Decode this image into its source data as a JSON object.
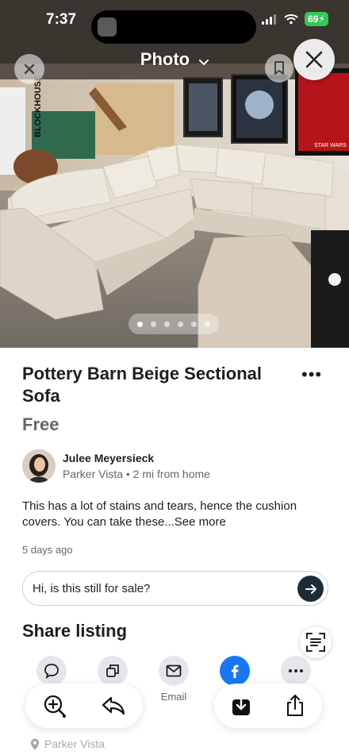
{
  "status_bar": {
    "time": "7:37",
    "battery": "69"
  },
  "header": {
    "title": "Photo"
  },
  "photo": {
    "image_count": 6,
    "active_index": 0
  },
  "listing": {
    "title": "Pottery Barn Beige Sectional Sofa",
    "price": "Free",
    "description": "This has a lot of stains and tears, hence the cushion covers. You can take these...",
    "see_more": "See more",
    "posted": "5 days ago"
  },
  "seller": {
    "name": "Julee Meyersieck",
    "location": "Parker Vista • 2 mi from home"
  },
  "message": {
    "text": "Hi, is this still for sale?"
  },
  "share": {
    "title": "Share listing",
    "items": [
      {
        "label": "",
        "icon": "chat-icon"
      },
      {
        "label": "",
        "icon": "copy-icon"
      },
      {
        "label": "Email",
        "icon": "email-icon"
      },
      {
        "label": "F",
        "icon": "facebook-icon"
      },
      {
        "label": "",
        "icon": "more-icon"
      }
    ]
  },
  "footer": {
    "location": "Parker Vista"
  },
  "colors": {
    "facebook_blue": "#1877f2",
    "send_button": "#1c2b3a",
    "battery_green": "#34c759"
  }
}
